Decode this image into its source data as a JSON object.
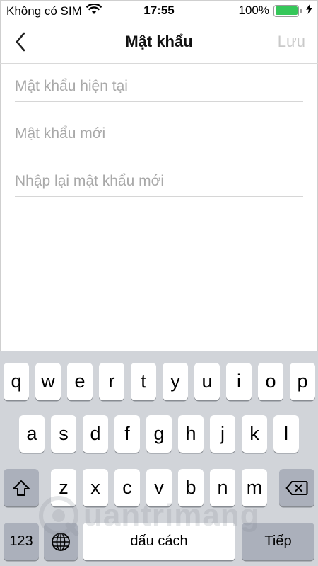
{
  "status_bar": {
    "carrier": "Không có SIM",
    "time": "17:55",
    "battery_percent": "100%",
    "battery_level": 1.0,
    "icons": [
      "wifi-icon",
      "battery-icon",
      "charging-bolt-icon"
    ]
  },
  "nav": {
    "title": "Mật khẩu",
    "save_label": "Lưu",
    "back_icon": "chevron-left-icon"
  },
  "fields": {
    "current_password_placeholder": "Mật khẩu hiện tại",
    "new_password_placeholder": "Mật khẩu mới",
    "confirm_password_placeholder": "Nhập lại mật khẩu mới"
  },
  "keyboard": {
    "row1": [
      "q",
      "w",
      "e",
      "r",
      "t",
      "y",
      "u",
      "i",
      "o",
      "p"
    ],
    "row2": [
      "a",
      "s",
      "d",
      "f",
      "g",
      "h",
      "j",
      "k",
      "l"
    ],
    "row3": [
      "z",
      "x",
      "c",
      "v",
      "b",
      "n",
      "m"
    ],
    "numbers_label": "123",
    "space_label": "dấu cách",
    "return_label": "Tiếp",
    "icons": [
      "shift-icon",
      "backspace-icon",
      "globe-icon"
    ]
  },
  "watermark": {
    "text": "uantrimang"
  },
  "colors": {
    "battery_green": "#35c759",
    "keyboard_bg": "#d1d4d9",
    "key_dark": "#abb0bb",
    "save_disabled": "#c9c9c9"
  }
}
